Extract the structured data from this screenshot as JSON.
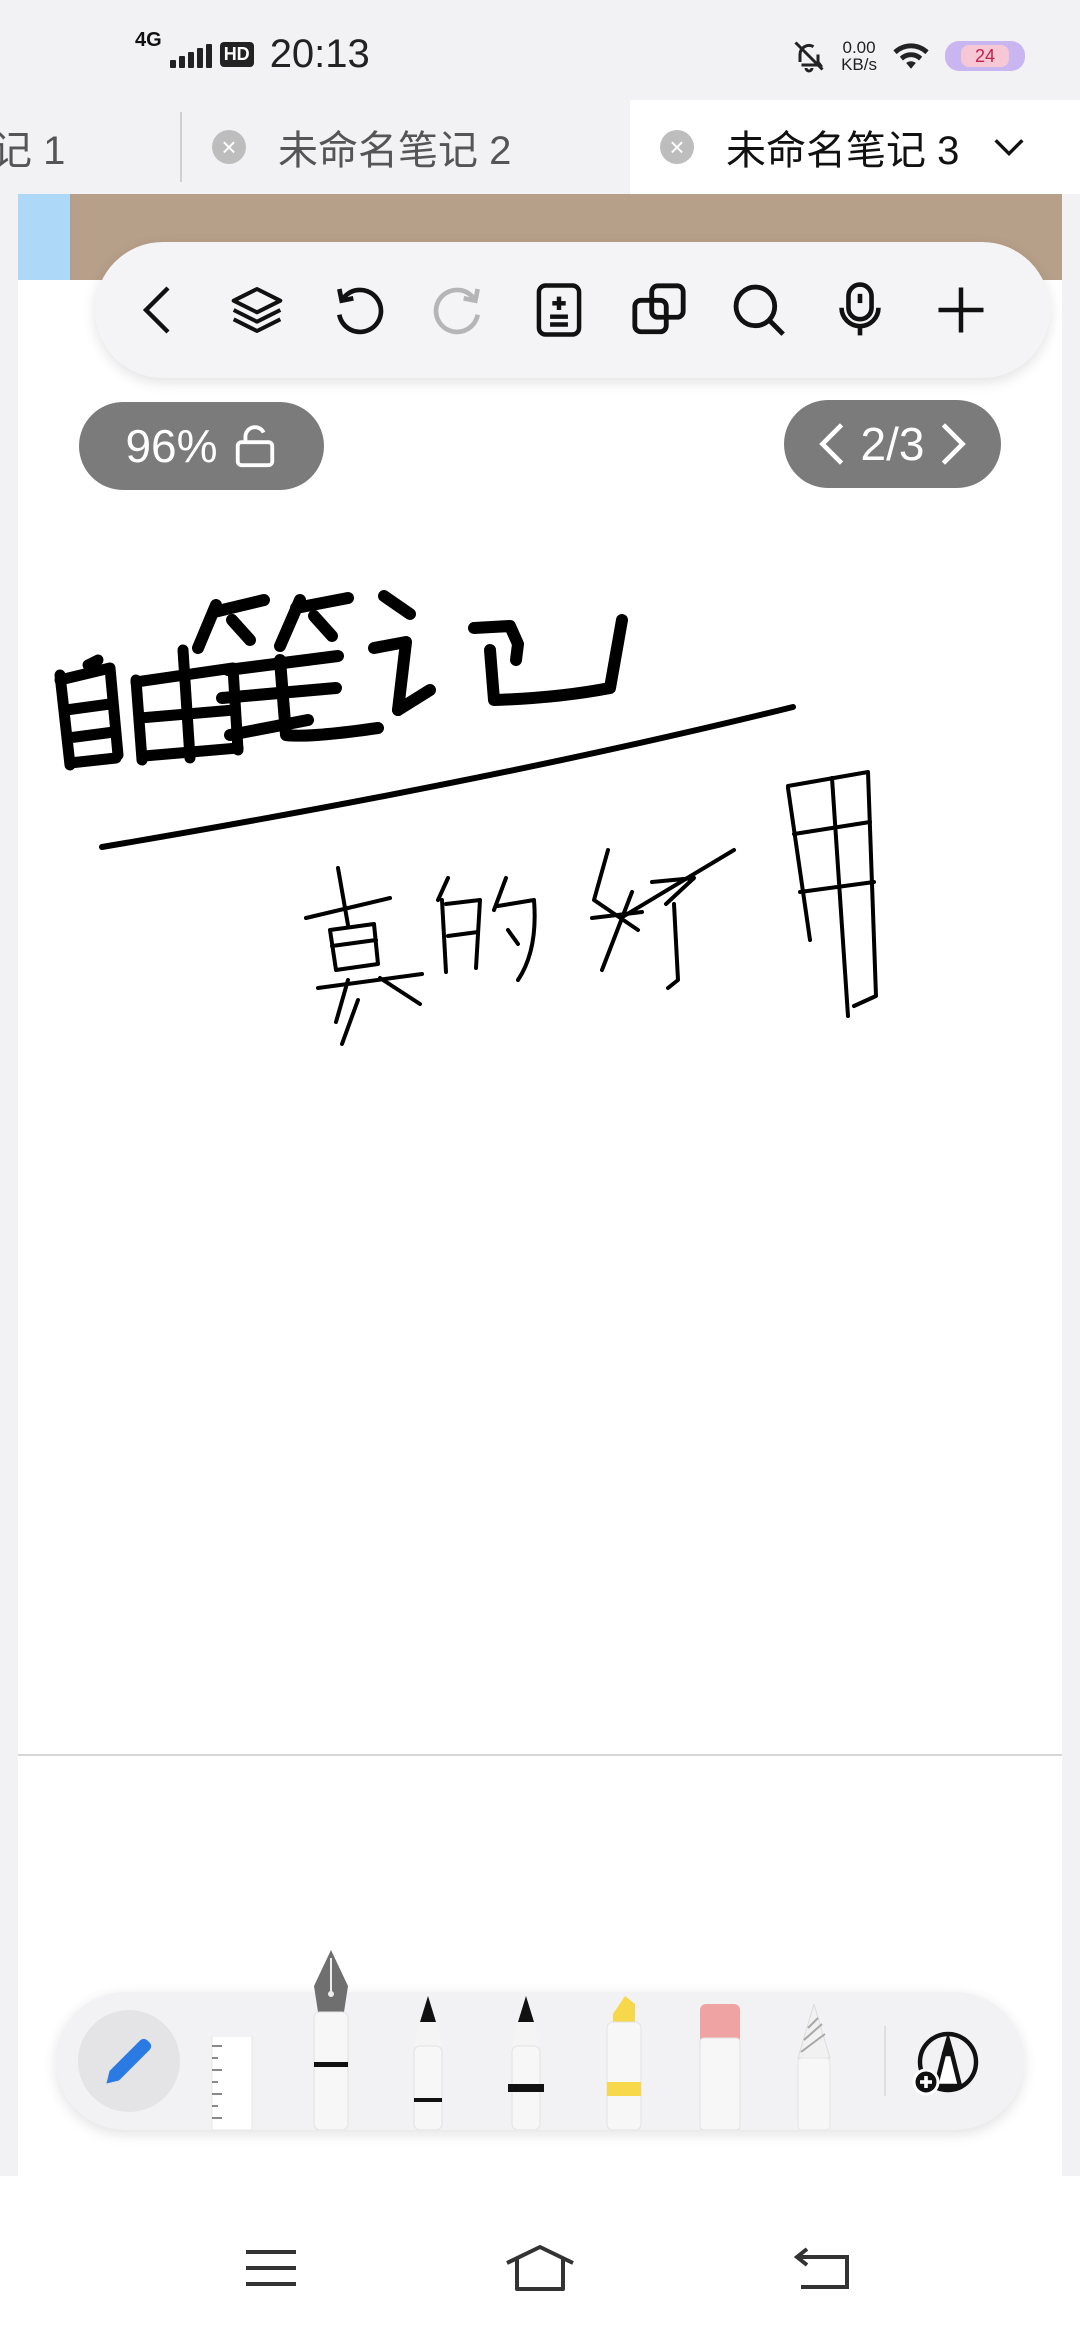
{
  "status_bar": {
    "network": "4G",
    "hd": "HD",
    "time": "20:13",
    "speed_value": "0.00",
    "speed_unit": "KB/s",
    "battery": "24"
  },
  "tabs": [
    {
      "label": "记 1",
      "active": false
    },
    {
      "label": "未命名笔记 2",
      "active": false
    },
    {
      "label": "未命名笔记 3",
      "active": true
    }
  ],
  "toolbar": {
    "icons": [
      "back-icon",
      "layers-icon",
      "undo-icon",
      "redo-icon",
      "page-add-icon",
      "copy-icon",
      "search-icon",
      "microphone-icon",
      "add-icon"
    ]
  },
  "zoom": {
    "label": "96%"
  },
  "page_indicator": {
    "label": "2/3",
    "current": 2,
    "total": 3
  },
  "pen_tools": [
    "pen-mode",
    "ruler",
    "fountain-pen",
    "ballpoint-pen",
    "marker-pen",
    "highlighter",
    "eraser",
    "pencil",
    "more-tools"
  ],
  "colors": {
    "accent_blue": "#2a7ae4",
    "highlighter_yellow": "#f6d84a",
    "eraser_pink": "#f0a3a3",
    "cover_brown": "#b7a08a",
    "pill_gray": "#7b7b7b"
  }
}
